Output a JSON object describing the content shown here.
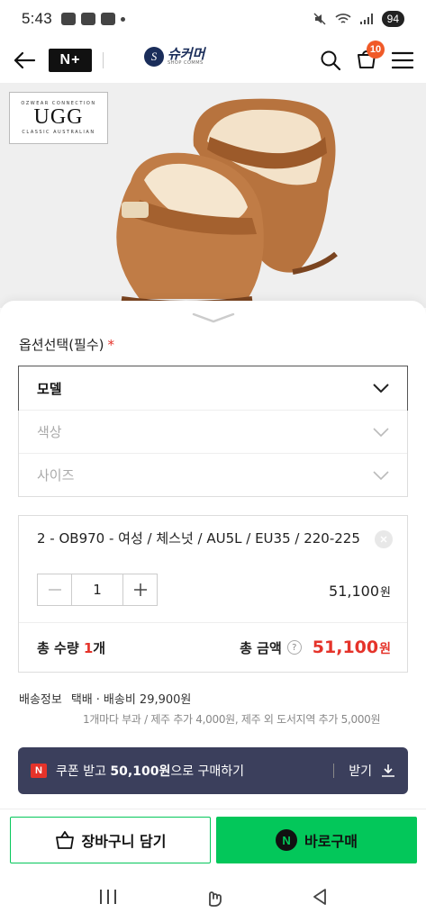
{
  "status_bar": {
    "time": "5:43",
    "left_icons": [
      "talk-icon",
      "screen-icon",
      "nplus-icon"
    ],
    "battery": "94"
  },
  "header": {
    "nplus_label": "N+",
    "logo_text": "슈커머",
    "logo_sub": "SHOP COMMS",
    "cart_count": "10"
  },
  "product": {
    "brand_top": "OZWEAR CONNECTION",
    "brand_main": "UGG",
    "brand_bottom": "CLASSIC AUSTRALIAN"
  },
  "options": {
    "title": "옵션선택(필수)",
    "required_mark": "*",
    "rows": [
      {
        "label": "모델",
        "state": "active"
      },
      {
        "label": "색상",
        "state": "disabled"
      },
      {
        "label": "사이즈",
        "state": "disabled"
      }
    ]
  },
  "selected_item": {
    "name": "2 - OB970 - 여성 / 체스넛 / AU5L / EU35 / 220-225",
    "quantity": "1",
    "price": "51,100",
    "price_unit": "원"
  },
  "total": {
    "qty_label": "총 수량",
    "qty_value": "1",
    "qty_unit": "개",
    "amount_label": "총 금액",
    "help": "?",
    "amount": "51,100",
    "amount_unit": "원"
  },
  "shipping": {
    "label": "배송정보",
    "method": "택배",
    "fee": "배송비 29,900원",
    "note": "1개마다 부과 / 제주 추가 4,000원, 제주 외 도서지역 추가 5,000원"
  },
  "coupon": {
    "badge": "N",
    "text_prefix": "쿠폰 받고 ",
    "amount": "50,100원",
    "text_suffix": "으로 구매하기",
    "action": "받기"
  },
  "buttons": {
    "cart": "장바구니 담기",
    "buy": "바로구매",
    "buy_badge": "N"
  },
  "colors": {
    "accent_green": "#03c75a",
    "price_red": "#e5332a",
    "coupon_bg": "#3b3f5c",
    "cart_badge": "#f05a28"
  }
}
